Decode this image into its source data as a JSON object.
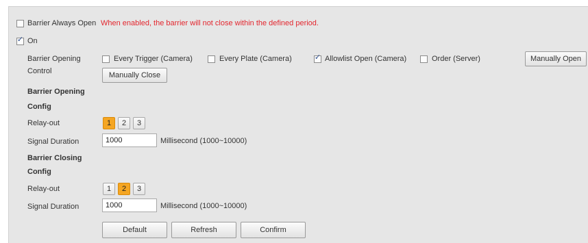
{
  "always_open": {
    "label": "Barrier Always Open",
    "checked": false,
    "warning": "When enabled, the barrier will not close within the defined period.",
    "warning_color": "#e3262e"
  },
  "on_toggle": {
    "label": "On",
    "checked": true
  },
  "control": {
    "label_line1": "Barrier Opening",
    "label_line2": "Control",
    "options": [
      {
        "label": "Every Trigger (Camera)",
        "checked": false
      },
      {
        "label": "Every Plate (Camera)",
        "checked": false
      },
      {
        "label": "Allowlist Open (Camera)",
        "checked": true
      },
      {
        "label": "Order (Server)",
        "checked": false
      }
    ],
    "manual_open_label": "Manually Open",
    "manual_close_label": "Manually Close"
  },
  "opening_config": {
    "heading_line1": "Barrier Opening",
    "heading_line2": "Config",
    "relay_label": "Relay-out",
    "relays": [
      "1",
      "2",
      "3"
    ],
    "active_relay": "1",
    "duration_label": "Signal Duration",
    "duration_value": "1000",
    "duration_hint": "Millisecond (1000~10000)"
  },
  "closing_config": {
    "heading_line1": "Barrier Closing",
    "heading_line2": "Config",
    "relay_label": "Relay-out",
    "relays": [
      "1",
      "2",
      "3"
    ],
    "active_relay": "2",
    "duration_label": "Signal Duration",
    "duration_value": "1000",
    "duration_hint": "Millisecond (1000~10000)"
  },
  "actions": {
    "default_label": "Default",
    "refresh_label": "Refresh",
    "confirm_label": "Confirm"
  },
  "colors": {
    "accent": "#f5a623",
    "panel_bg": "#e6e6e6",
    "check": "#2d4f8f"
  }
}
